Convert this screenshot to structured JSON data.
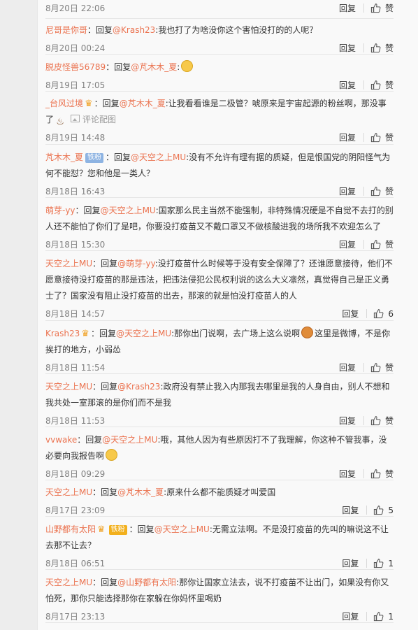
{
  "reply_label": "回复",
  "like_placeholder": "赞",
  "comments": [
    {
      "user": "",
      "reply_to": "",
      "body": "",
      "time": "8月20日 22:06",
      "likes": "赞"
    },
    {
      "user": "尼哥是你哥",
      "reply_to": "@Krash23",
      "body": ":我也打了为啥没你这个害怕没打的的人呢？",
      "time": "8月20日 00:24",
      "likes": "赞"
    },
    {
      "user": "脱皮怪兽56789",
      "reply_to": "@芃木木_夏",
      "body": ":",
      "time": "8月19日 17:05",
      "likes": "赞"
    },
    {
      "user": "_台风过境",
      "reply_to": "@芃木木_夏",
      "body": ":让我看看谁是二极管？唬原来是宇宙起源的粉丝啊，那没事了",
      "pic_label": "评论配图",
      "time": "8月19日 14:48",
      "likes": "赞"
    },
    {
      "user": "芃木木_夏",
      "badge": "铁粉",
      "reply_to": "@天空之上MU",
      "body": ":没有不允许有理有据的质疑，但是恨国党的阴阳怪气为何不能怼？您和他是一类人？",
      "time": "8月18日 16:43",
      "likes": "赞"
    },
    {
      "user": "萌芽-yy",
      "reply_to": "@天空之上MU",
      "body": ":国家那么民主当然不能强制，非特殊情况硬是不自觉不去打的别人还不能怕了你们了是吧，你要没打疫苗又不戴口罩又不做核酸进我的场所我不欢迎怎么了",
      "time": "8月18日 15:30",
      "likes": "赞"
    },
    {
      "user": "天空之上MU",
      "reply_to": "@萌芽-yy",
      "body": ":没打疫苗什么时候等于没有安全保障了？还谁愿意接待，他们不愿意接待没打疫苗的那是违法，把违法侵犯公民权利说的这么大义凛然，真觉得自己是正义勇士了？国家没有阻止没打疫苗的出去，那滚的就是怕没打疫苗人的人",
      "time": "8月18日 14:57",
      "likes": "6"
    },
    {
      "user": "Krash23",
      "reply_to": "@天空之上MU",
      "body": ":那你出门说啊，去广场上这么说啊",
      "body2": "这里是微博，不是你挨打的地方，小弱怂",
      "time": "8月18日 11:54",
      "likes": "赞"
    },
    {
      "user": "天空之上MU",
      "reply_to": "@Krash23",
      "body": ":政府没有禁止我入内那我去哪里是我的人身自由，别人不想和我共处一室那滚的是你们而不是我",
      "time": "8月18日 11:53",
      "likes": "赞"
    },
    {
      "user": "vvwake",
      "reply_to": "@天空之上MU",
      "body": ":哦，其他人因为有些原因打不了我理解，你这种不管我事，没必要向我报告啊",
      "time": "8月18日 09:29",
      "likes": "赞"
    },
    {
      "user": "天空之上MU",
      "reply_to": "@芃木木_夏",
      "body": ":原来什么都不能质疑才叫爱国",
      "time": "8月17日 23:09",
      "likes": "5"
    },
    {
      "user": "山野都有太阳",
      "badge": "铁粉",
      "reply_to": "@天空之上MU",
      "body": ":无需立法啊。不是没打疫苗的先叫的嘛说这不让去那不让去？",
      "time": "8月18日 06:51",
      "likes": "1"
    },
    {
      "user": "天空之上MU",
      "reply_to": "@山野都有太阳",
      "body": ":那你让国家立法去，说不打疫苗不让出门，如果没有你又怕死，那你只能选择那你在家躲在你妈怀里喝奶",
      "time": "8月17日 23:13",
      "likes": "1"
    }
  ]
}
